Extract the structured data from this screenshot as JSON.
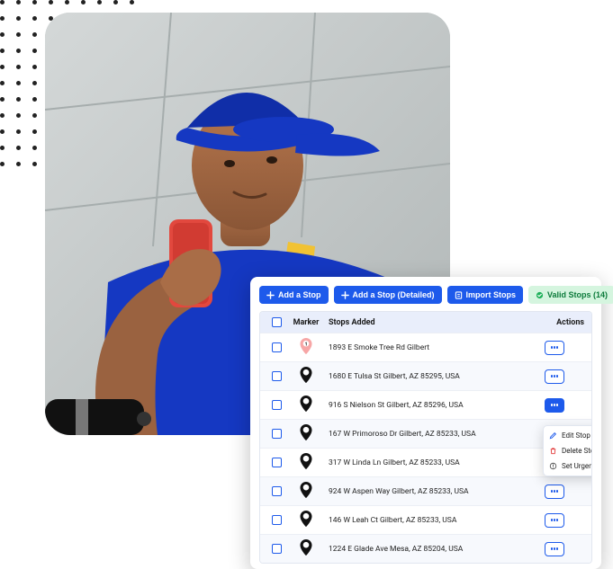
{
  "toolbar": {
    "add_label": "Add a Stop",
    "add_detailed_label": "Add a Stop (Detailed)",
    "import_label": "Import Stops",
    "valid_label": "Valid Stops (14)"
  },
  "table": {
    "header_marker": "Marker",
    "header_stops": "Stops Added",
    "header_actions": "Actions"
  },
  "stops": [
    {
      "marker_num": "1",
      "marker_color": "#F7A6A6",
      "address": "1893 E Smoke Tree Rd Gilbert",
      "status": "error",
      "action_style": "outline"
    },
    {
      "marker_num": "2",
      "marker_color": "#111111",
      "address": "1680 E Tulsa St Gilbert, AZ 85295, USA",
      "status": "ok",
      "action_style": "outline"
    },
    {
      "marker_num": "3",
      "marker_color": "#111111",
      "address": "916 S Nielson St Gilbert, AZ 85296, USA",
      "status": "ok",
      "action_style": "solid"
    },
    {
      "marker_num": "4",
      "marker_color": "#111111",
      "address": "167 W Primoroso Dr Gilbert, AZ 85233, USA",
      "status": "ok",
      "action_style": "outline"
    },
    {
      "marker_num": "5",
      "marker_color": "#111111",
      "address": "317 W Linda Ln Gilbert, AZ 85233, USA",
      "status": "ok",
      "action_style": "outline"
    },
    {
      "marker_num": "6",
      "marker_color": "#111111",
      "address": "924 W Aspen Way Gilbert, AZ 85233, USA",
      "status": "ok",
      "action_style": "outline"
    },
    {
      "marker_num": "7",
      "marker_color": "#111111",
      "address": "146 W Leah Ct Gilbert, AZ 85233, USA",
      "status": "ok",
      "action_style": "outline"
    },
    {
      "marker_num": "8",
      "marker_color": "#111111",
      "address": "1224 E Glade Ave Mesa, AZ 85204, USA",
      "status": "ok",
      "action_style": "outline"
    }
  ],
  "popup": {
    "row_index": 3,
    "edit": "Edit Stop",
    "delete": "Delete Stop",
    "urgent": "Set Urgent"
  }
}
